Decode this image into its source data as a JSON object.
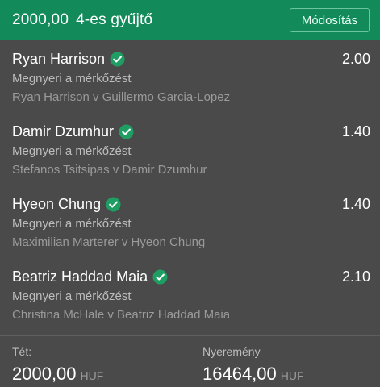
{
  "header": {
    "stake": "2000,00",
    "bet_type": "4-es gyűjtő",
    "edit_label": "Módosítás"
  },
  "bets": [
    {
      "selection": "Ryan Harrison",
      "odds": "2.00",
      "market": "Megnyeri a mérkőzést",
      "event": "Ryan Harrison v Guillermo Garcia-Lopez"
    },
    {
      "selection": "Damir Dzumhur",
      "odds": "1.40",
      "market": "Megnyeri a mérkőzést",
      "event": "Stefanos Tsitsipas v Damir Dzumhur"
    },
    {
      "selection": "Hyeon Chung",
      "odds": "1.40",
      "market": "Megnyeri a mérkőzést",
      "event": "Maximilian Marterer v Hyeon Chung"
    },
    {
      "selection": "Beatriz Haddad Maia",
      "odds": "2.10",
      "market": "Megnyeri a mérkőzést",
      "event": "Christina McHale v Beatriz Haddad Maia"
    }
  ],
  "footer": {
    "stake_label": "Tét:",
    "stake_value": "2000,00",
    "stake_currency": "HUF",
    "win_label": "Nyeremény",
    "win_value": "16464,00",
    "win_currency": "HUF"
  },
  "colors": {
    "header_bg": "#128a5a",
    "body_bg": "#4a4a4a",
    "check_green": "#1f9e63"
  },
  "icons": {
    "check": "check-circle-icon"
  }
}
